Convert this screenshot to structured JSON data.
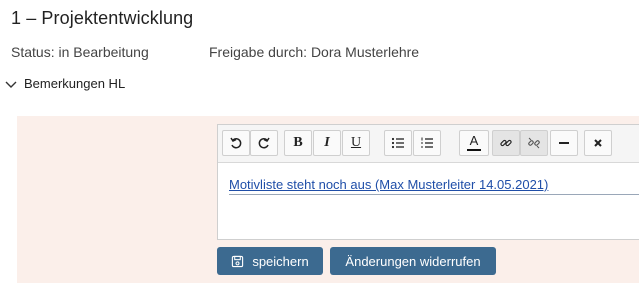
{
  "page": {
    "title": "1 – Projektentwicklung",
    "status": "Status: in Bearbeitung",
    "release": "Freigabe durch: Dora Musterlehre"
  },
  "section": {
    "label": "Bemerkungen HL",
    "expanded": true
  },
  "toolbar": {
    "buttons": [
      {
        "name": "undo",
        "icon": "undo-icon"
      },
      {
        "name": "redo",
        "icon": "redo-icon"
      },
      {
        "name": "bold",
        "label": "B"
      },
      {
        "name": "italic",
        "label": "I"
      },
      {
        "name": "underline",
        "label": "U"
      },
      {
        "name": "bullet-list",
        "icon": "bullet-list-icon"
      },
      {
        "name": "numbered-list",
        "icon": "numbered-list-icon"
      },
      {
        "name": "text-color",
        "label": "A"
      },
      {
        "name": "link",
        "icon": "link-icon"
      },
      {
        "name": "unlink",
        "icon": "unlink-icon"
      },
      {
        "name": "horizontal-rule",
        "icon": "horizontal-rule-icon"
      },
      {
        "name": "clear-format",
        "icon": "clear-format-icon"
      }
    ]
  },
  "editor": {
    "content": "Motivliste steht noch aus (Max Musterleiter 14.05.2021)"
  },
  "actions": {
    "save_label": "speichern",
    "revert_label": "Änderungen widerrufen"
  },
  "colors": {
    "panel_bg": "#fbefea",
    "button_bg": "#3c6a90",
    "link": "#1f4ea8"
  }
}
